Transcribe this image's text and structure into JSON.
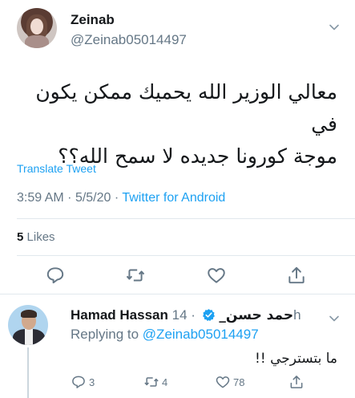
{
  "tweet": {
    "display_name": "Zeinab",
    "handle": "@Zeinab05014497",
    "text_line1": "معالي الوزير الله يحميك ممكن يكون في",
    "text_line2": "موجة كورونا جديده لا سمح الله؟؟",
    "translate_label": "Translate Tweet",
    "time": "3:59 AM",
    "date": "5/5/20",
    "separator": "·",
    "app": "Twitter for Android",
    "likes_count": "5",
    "likes_label": "Likes",
    "icons": [
      "reply-icon",
      "retweet-icon",
      "like-icon",
      "share-icon",
      "chevron-down-icon"
    ]
  },
  "reply": {
    "display_name": "Hamad Hassan",
    "display_name_ar": "حمد حسن_",
    "time": "· 14h",
    "replying_label": "Replying to",
    "replying_handle": "@Zeinab05014497",
    "text": "ما بتسترجي !!",
    "reply_count": "3",
    "retweet_count": "4",
    "like_count": "78",
    "colors": {
      "verified": "#1da1f2",
      "accent": "#1da1f2",
      "muted": "#657786"
    }
  }
}
